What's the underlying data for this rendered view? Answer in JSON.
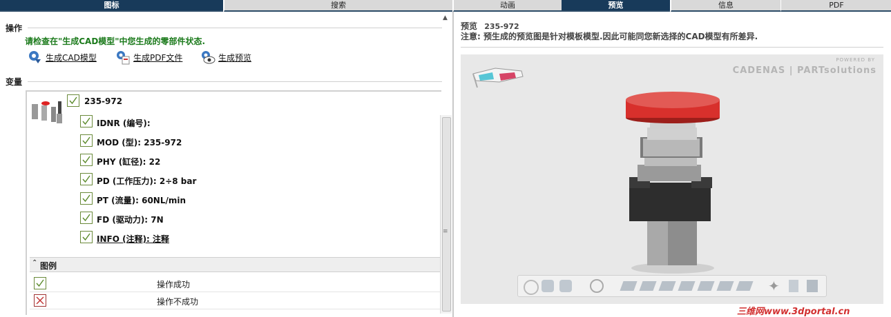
{
  "tabs": [
    "图标",
    "搜索",
    "动画",
    "预览",
    "信息",
    "PDF"
  ],
  "left": {
    "actions_title": "操作",
    "warning": "请检查在\"生成CAD模型\"中您生成的零部件状态.",
    "actions": [
      {
        "label": "生成CAD模型",
        "icon": "cad-gear-icon"
      },
      {
        "label": "生成PDF文件",
        "icon": "pdf-gear-icon"
      },
      {
        "label": "生成预览",
        "icon": "eye-preview-icon"
      }
    ],
    "variants_title": "变量",
    "variant": {
      "id": "235-972",
      "props": [
        {
          "label": "IDNR (编号):",
          "link": false
        },
        {
          "label": "MOD (型): 235-972",
          "link": false
        },
        {
          "label": "PHY (缸径): 22",
          "link": false
        },
        {
          "label": "PD (工作压力): 2÷8 bar",
          "link": false
        },
        {
          "label": "PT (流量): 60NL/min",
          "link": false
        },
        {
          "label": "FD (驱动力): 7N",
          "link": false
        },
        {
          "label": "INFO (注释): 注释",
          "link": true
        }
      ]
    },
    "legend": {
      "title": "图例",
      "items": [
        {
          "label": "操作成功",
          "status": "success"
        },
        {
          "label": "操作不成功",
          "status": "fail"
        }
      ]
    }
  },
  "right": {
    "preview_label": "预览",
    "preview_id": "235-972",
    "notice": "注意: 预生成的预览图是针对模板模型.因此可能同您新选择的CAD模型有所差异.",
    "brand_powered": "POWERED BY",
    "brand_name": "CADENAS | PARTsolutions",
    "watermark": "三维网www.3dportal.cn"
  },
  "colors": {
    "tab_active": "#183a5a",
    "tab_inactive": "#d9d9d9",
    "success_green": "#1b7a1b",
    "button_red": "#d8302c",
    "fail_red": "#c03030"
  }
}
